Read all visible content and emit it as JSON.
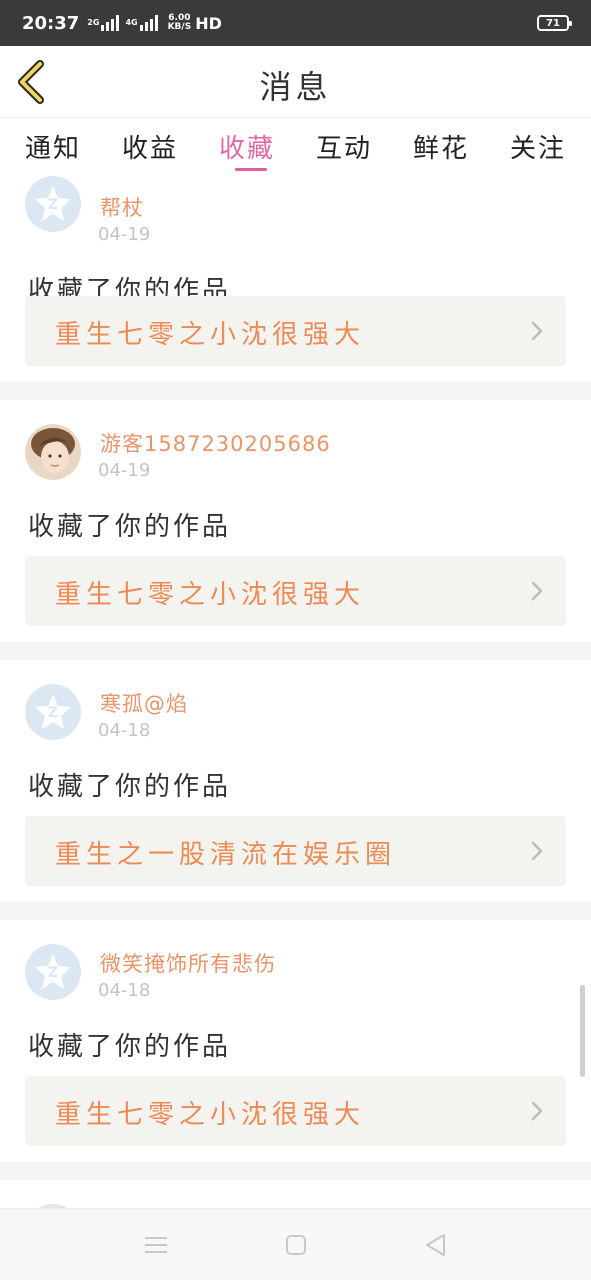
{
  "status_bar": {
    "time": "20:37",
    "network_1": "2G",
    "network_2": "4G",
    "speed_value": "6.00",
    "speed_unit": "KB/S",
    "hd": "HD",
    "battery": "71"
  },
  "header": {
    "title": "消息",
    "back_icon": "chevron-left-icon"
  },
  "tabs": [
    {
      "label": "通知",
      "active": false
    },
    {
      "label": "收益",
      "active": false
    },
    {
      "label": "收藏",
      "active": true
    },
    {
      "label": "互动",
      "active": false
    },
    {
      "label": "鲜花",
      "active": false
    },
    {
      "label": "关注",
      "active": false
    }
  ],
  "feed": [
    {
      "user": "帮杖",
      "date": "04-19",
      "action": "收藏了你的作品",
      "work": "重生七零之小沈很强大",
      "avatar": "default-avatar-icon"
    },
    {
      "user": "游客1587230205686",
      "date": "04-19",
      "action": "收藏了你的作品",
      "work": "重生七零之小沈很强大",
      "avatar": "user-photo"
    },
    {
      "user": "寒孤@焰",
      "date": "04-18",
      "action": "收藏了你的作品",
      "work": "重生之一股清流在娱乐圈",
      "avatar": "default-avatar-icon"
    },
    {
      "user": "微笑掩饰所有悲伤",
      "date": "04-18",
      "action": "收藏了你的作品",
      "work": "重生七零之小沈很强大",
      "avatar": "default-avatar-icon"
    }
  ],
  "colors": {
    "accent_tab": "#e06aa4",
    "username": "#e8956a",
    "work_title": "#ef8a55",
    "work_bg": "#f3f3ef",
    "status_bar_bg": "#3a3a3a"
  },
  "navbar": {
    "menu_icon": "menu-icon",
    "home_icon": "home-square-icon",
    "back_icon": "back-triangle-icon"
  }
}
